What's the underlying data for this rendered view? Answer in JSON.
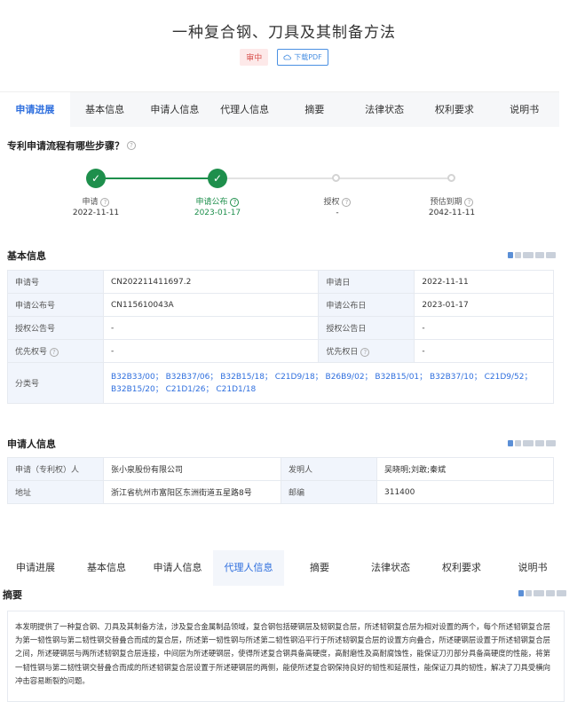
{
  "patent": {
    "title": "一种复合钢、刀具及其制备方法",
    "status": "审中",
    "pdf_label": "下载PDF"
  },
  "tabs": [
    "申请进展",
    "基本信息",
    "申请人信息",
    "代理人信息",
    "摘要",
    "法律状态",
    "权利要求",
    "说明书"
  ],
  "progress": {
    "title": "专利申请流程有哪些步骤？",
    "steps": [
      {
        "label": "申请",
        "date": "2022-11-11",
        "done": true
      },
      {
        "label": "申请公布",
        "date": "2023-01-17",
        "done": true
      },
      {
        "label": "授权",
        "date": "-",
        "done": false
      },
      {
        "label": "预估到期",
        "date": "2042-11-11",
        "done": false
      }
    ]
  },
  "basic_info": {
    "title": "基本信息",
    "rows": [
      {
        "k1": "申请号",
        "v1": "CN202211411697.2",
        "k2": "申请日",
        "v2": "2022-11-11"
      },
      {
        "k1": "申请公布号",
        "v1": "CN115610043A",
        "k2": "申请公布日",
        "v2": "2023-01-17"
      },
      {
        "k1": "授权公告号",
        "v1": "-",
        "k2": "授权公告日",
        "v2": "-"
      },
      {
        "k1": "优先权号",
        "v1": "-",
        "k2": "优先权日",
        "v2": "-"
      }
    ],
    "class_label": "分类号",
    "class_line1": "B32B33/00； B32B37/06； B32B15/18； C21D9/18； B26B9/02； B32B15/01； B32B37/10； C21D9/52；",
    "class_line2": "B32B15/20； C21D1/26； C21D1/18"
  },
  "applicant_info": {
    "title": "申请人信息",
    "applicant_label": "申请（专利权）人",
    "applicant": "张小泉股份有限公司",
    "inventor_label": "发明人",
    "inventors": "吴晓明;刘敢;秦斌",
    "address_label": "地址",
    "address": "浙江省杭州市富阳区东洲街道五星路8号",
    "postcode_label": "邮编",
    "postcode": "311400"
  },
  "abstract": {
    "title": "摘要",
    "text": "本发明提供了一种复合钢、刀具及其制备方法，涉及复合金属制品领域，复合钢包括硬钢层及韧钢复合层，所述韧钢复合层为相对设置的两个，每个所述韧钢复合层为第一韧性钢与第二韧性钢交替叠合而成的复合层，所述第一韧性钢与所述第二韧性钢沿平行于所述韧钢复合层的设置方向叠合，所述硬钢层设置于所述韧钢复合层之间，所述硬钢层与两所述韧钢复合层连接，中间层为所述硬钢层，使得所述复合钢具备高硬度，高耐磨性及高耐腐蚀性，能保证刀刃部分具备高硬度的性能，将第一韧性钢与第二韧性钢交替叠合而成的所述韧钢复合层设置于所述硬钢层的两侧，能使所述复合钢保持良好的韧性和延展性，能保证刀具的韧性，解决了刀具受横向冲击容易断裂的问题。"
  },
  "colors": {
    "accent": "#2f6fde",
    "done": "#1e8f4c",
    "status": "#d9534f"
  }
}
